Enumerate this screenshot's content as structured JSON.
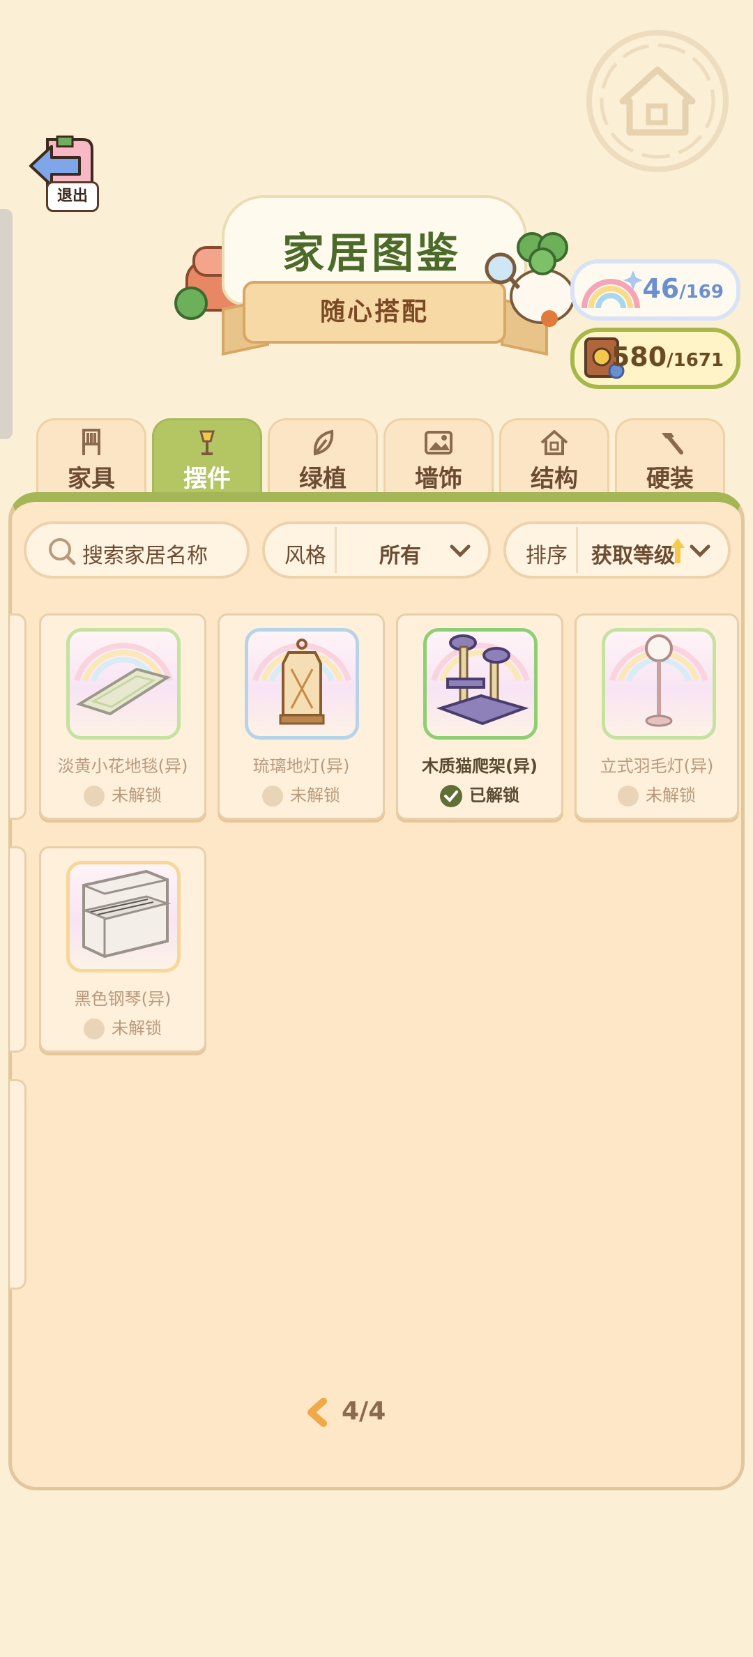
{
  "header": {
    "exit_label": "退出",
    "title": "家居图鉴",
    "subtitle": "随心搭配"
  },
  "counters": {
    "collection": {
      "value": "46",
      "total": "/169"
    },
    "points": {
      "value": "580",
      "total": "/1671"
    }
  },
  "tabs": [
    {
      "label": "家具",
      "icon": "chair-icon",
      "active": false
    },
    {
      "label": "摆件",
      "icon": "lamp-icon",
      "active": true
    },
    {
      "label": "绿植",
      "icon": "leaf-icon",
      "active": false
    },
    {
      "label": "墙饰",
      "icon": "picture-icon",
      "active": false
    },
    {
      "label": "结构",
      "icon": "house-icon",
      "active": false
    },
    {
      "label": "硬装",
      "icon": "hammer-icon",
      "active": false
    }
  ],
  "filters": {
    "search_placeholder": "搜索家居名称",
    "style_label": "风格",
    "style_value": "所有",
    "sort_label": "排序",
    "sort_value": "获取等级"
  },
  "items": [
    {
      "name": "淡黄小花地毯(异)",
      "status": "未解锁",
      "unlocked": false,
      "icon": "rug-icon"
    },
    {
      "name": "琉璃地灯(异)",
      "status": "未解锁",
      "unlocked": false,
      "icon": "lantern-icon"
    },
    {
      "name": "木质猫爬架(异)",
      "status": "已解锁",
      "unlocked": true,
      "icon": "cat-tree-icon"
    },
    {
      "name": "立式羽毛灯(异)",
      "status": "未解锁",
      "unlocked": false,
      "icon": "floor-lamp-icon"
    },
    {
      "name": "黑色钢琴(异)",
      "status": "未解锁",
      "unlocked": false,
      "icon": "piano-icon"
    }
  ],
  "pagination": {
    "text": "4/4"
  },
  "colors": {
    "accent_green": "#a5b657",
    "background": "#fbefd6",
    "unlocked_check": "#5f6f35",
    "pager_arrow": "#f0a848"
  }
}
